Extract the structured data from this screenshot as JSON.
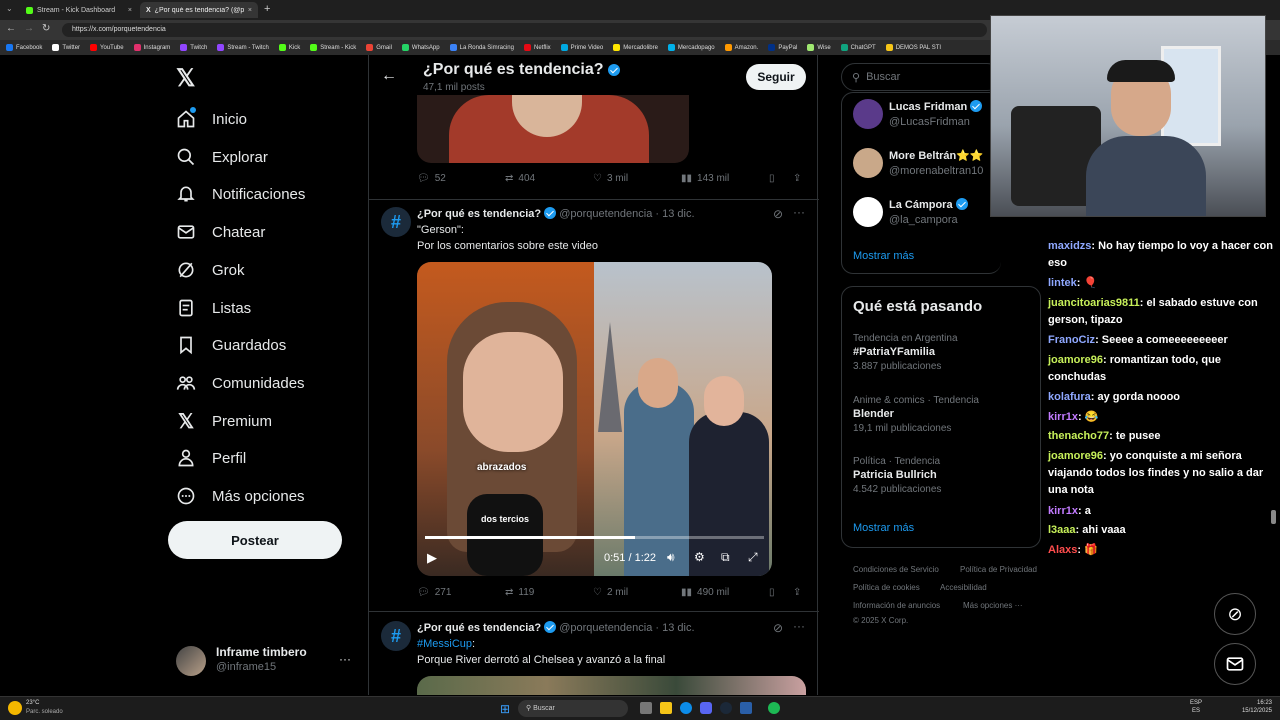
{
  "browser": {
    "tabs": [
      {
        "title": "Stream - Kick Dashboard",
        "close": "×"
      },
      {
        "title": "¿Por qué es tendencia? (@porquet",
        "close": "×"
      }
    ],
    "new_tab": "+",
    "url": "https://x.com/porquetendencia",
    "bookmarks": [
      "Facebook",
      "Twitter",
      "YouTube",
      "Instagram",
      "Twitch",
      "Stream - Twitch",
      "Kick",
      "Stream - Kick",
      "Gmail",
      "WhatsApp",
      "La Ronda Simracing",
      "Netflix",
      "Prime Video",
      "Mercadolibre",
      "Mercadopago",
      "Amazon.",
      "PayPal",
      "Wise",
      "ChatGPT",
      "DEMOS PAL STI"
    ]
  },
  "nav": {
    "items": [
      "Inicio",
      "Explorar",
      "Notificaciones",
      "Chatear",
      "Grok",
      "Listas",
      "Guardados",
      "Comunidades",
      "Premium",
      "Perfil",
      "Más opciones"
    ],
    "post": "Postear",
    "account_name": "Inframe timbero",
    "account_handle": "@inframe15",
    "more": "···"
  },
  "header": {
    "title": "¿Por qué es tendencia?",
    "subtitle": "47,1 mil posts",
    "follow": "Seguir"
  },
  "post0": {
    "replies": "52",
    "reposts": "404",
    "likes": "3 mil",
    "views": "143 mil"
  },
  "post1": {
    "name": "¿Por qué es tendencia?",
    "handle": "@porquetendencia",
    "date": "· 13 dic.",
    "line1": "\"Gerson\":",
    "line2": "Por los comentarios sobre este video",
    "caption": "abrazados",
    "mic": "dos tercios",
    "time": "0:51 / 1:22",
    "replies": "271",
    "reposts": "119",
    "likes": "2 mil",
    "views": "490 mil"
  },
  "post2": {
    "name": "¿Por qué es tendencia?",
    "handle": "@porquetendencia",
    "date": "· 13 dic.",
    "hashtag": "#MessiCup",
    "line2": "Porque River derrotó al Chelsea y avanzó a la final"
  },
  "right": {
    "search": "Buscar",
    "follow_suggestions": [
      {
        "name": "Lucas Fridman",
        "handle": "@LucasFridman"
      },
      {
        "name": "More Beltrán⭐⭐",
        "handle": "@morenabeltran10"
      },
      {
        "name": "La Cámpora",
        "handle": "@la_campora"
      }
    ],
    "show_more": "Mostrar más",
    "trends_title": "Qué está pasando",
    "trends": [
      {
        "context": "Tendencia en Argentina",
        "name": "#PatriaYFamilia",
        "count": "3.887 publicaciones"
      },
      {
        "context": "Anime & comics · Tendencia",
        "name": "Blender",
        "count": "19,1 mil publicaciones"
      },
      {
        "context": "Política · Tendencia",
        "name": "Patricia Bullrich",
        "count": "4.542 publicaciones"
      }
    ],
    "show_more2": "Mostrar más",
    "footer": [
      "Condiciones de Servicio",
      "Política de Privacidad",
      "Política de cookies",
      "Accesibilidad",
      "Información de anuncios",
      "Más opciones ···",
      "© 2025 X Corp."
    ]
  },
  "chat": [
    {
      "user": "maxidzs",
      "color": "#8fa8ff",
      "text": ": No hay tiempo lo voy a hacer con eso"
    },
    {
      "user": "lintek",
      "color": "#8fa8ff",
      "text": ": 🎈"
    },
    {
      "user": "juancitoarias9811",
      "color": "#c7f05a",
      "text": ": el sabado estuve con gerson, tipazo"
    },
    {
      "user": "FranoCiz",
      "color": "#8fa8ff",
      "text": ": Seeee a comeeeeeeeeer"
    },
    {
      "user": "joamore96",
      "color": "#c7f05a",
      "text": ": romantizan todo, que conchudas"
    },
    {
      "user": "kolafura",
      "color": "#8fa8ff",
      "text": ": ay gorda noooo"
    },
    {
      "user": "kirr1x",
      "color": "#c27bff",
      "text": ": 😂"
    },
    {
      "user": "thenacho77",
      "color": "#c7f05a",
      "text": ": te pusee"
    },
    {
      "user": "joamore96",
      "color": "#c7f05a",
      "text": ": yo conquiste a mi señora viajando todos los findes y no salio a dar una nota"
    },
    {
      "user": "kirr1x",
      "color": "#c27bff",
      "text": ": a"
    },
    {
      "user": "l3aaa",
      "color": "#c7f05a",
      "text": ": ahi vaaa"
    },
    {
      "user": "Alaxs",
      "color": "#ff4d4d",
      "text": ": 🎁"
    }
  ],
  "taskbar": {
    "weather_temp": "23°C",
    "weather_desc": "Parc. soleado",
    "search": "Buscar",
    "lang": "ESP",
    "lang2": "ES",
    "time": "16:23",
    "date": "15/12/2025"
  },
  "colors": {
    "accent": "#1d9bf0",
    "bg": "#000000",
    "border": "#2f3336"
  }
}
